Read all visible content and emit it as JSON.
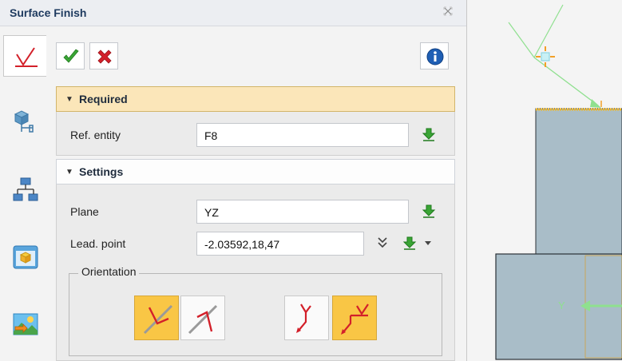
{
  "dialog": {
    "title": "Surface Finish",
    "close_icon": "close-icon"
  },
  "side_tabs": [
    {
      "name": "surface-finish-tab",
      "icon": "checkmark-symbol-icon",
      "active": true
    },
    {
      "name": "datum-tab",
      "icon": "datum-feature-icon"
    },
    {
      "name": "hierarchy-tab",
      "icon": "tree-structure-icon"
    },
    {
      "name": "view-tab",
      "icon": "cube-view-icon"
    },
    {
      "name": "render-tab",
      "icon": "landscape-image-icon"
    }
  ],
  "toolbar": {
    "ok_icon": "green-check-icon",
    "cancel_icon": "red-x-icon",
    "info_icon": "info-icon"
  },
  "required": {
    "header": "Required",
    "ref_entity_label": "Ref. entity",
    "ref_entity_value": "F8"
  },
  "settings": {
    "header": "Settings",
    "plane_label": "Plane",
    "plane_value": "YZ",
    "lead_point_label": "Lead. point",
    "lead_point_value": "-2.03592,18,47",
    "orientation_label": "Orientation",
    "orientation_buttons": [
      {
        "name": "orient-normal",
        "selected": true
      },
      {
        "name": "orient-reversed",
        "selected": false
      },
      {
        "name": "leader-left",
        "selected": false
      },
      {
        "name": "leader-right",
        "selected": true
      }
    ]
  },
  "colors": {
    "accent_yellow": "#f9c645",
    "required_header": "#fbe6b9",
    "pick_green": "#3aa535",
    "symbol_red": "#d3202a",
    "model_face": "#a9bdc8",
    "model_edge": "#2b3136"
  },
  "viewport": {
    "axis_label": "Y"
  }
}
